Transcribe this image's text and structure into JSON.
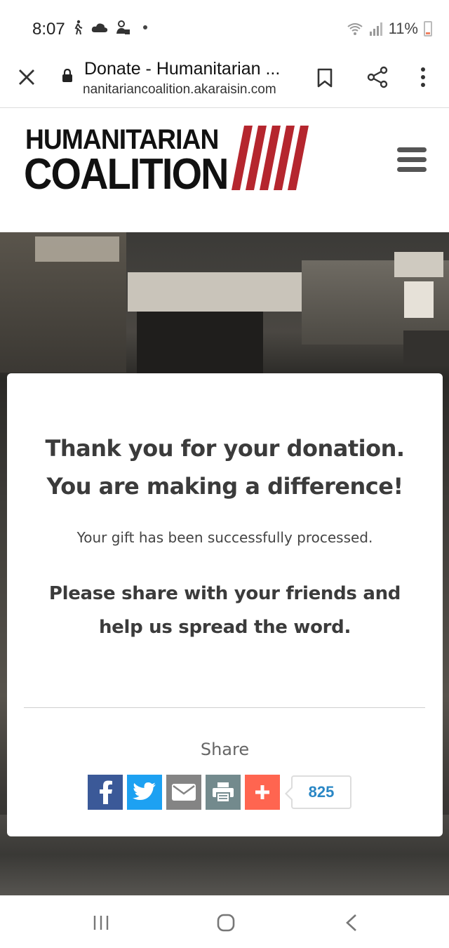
{
  "status_bar": {
    "time": "8:07",
    "battery": "11%",
    "icons": [
      "walking-icon",
      "cloud-icon",
      "notification-icon",
      "wifi-icon",
      "signal-icon",
      "battery-icon"
    ]
  },
  "browser": {
    "title": "Donate - Humanitarian ...",
    "url": "nanitariancoalition.akaraisin.com"
  },
  "site": {
    "logo_line1": "HUMANITARIAN",
    "logo_line2": "COALITION",
    "logo_stripe_color": "#b5262e"
  },
  "card": {
    "thanks_line1": "Thank you for your donation.",
    "thanks_line2": "You are making a difference!",
    "processed": "Your gift has been successfully processed.",
    "please_line1": "Please share with your friends and",
    "please_line2": "help us spread the word.",
    "share_label": "Share",
    "share_count": "825",
    "share_buttons": [
      {
        "name": "facebook",
        "color": "#3b5998"
      },
      {
        "name": "twitter",
        "color": "#1da1f2"
      },
      {
        "name": "email",
        "color": "#848484"
      },
      {
        "name": "print",
        "color": "#738a8d"
      },
      {
        "name": "more",
        "color": "#ff6550"
      }
    ]
  }
}
